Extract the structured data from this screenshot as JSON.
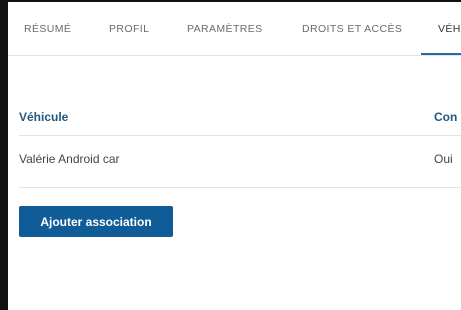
{
  "tabs": [
    {
      "label": "RÉSUMÉ",
      "active": false
    },
    {
      "label": "PROFIL",
      "active": false
    },
    {
      "label": "PARAMÈTRES",
      "active": false
    },
    {
      "label": "DROITS ET ACCÈS",
      "active": false
    },
    {
      "label": "VÉH",
      "active": true
    }
  ],
  "table": {
    "columns": [
      "Véhicule",
      "Con"
    ],
    "rows": [
      {
        "vehicle": "Valérie Android car",
        "status": "Oui"
      }
    ]
  },
  "actions": {
    "add_label": "Ajouter association"
  },
  "colors": {
    "accent": "#0f5c97",
    "header_text": "#24587f",
    "tab_underline": "#1e6fa8"
  }
}
